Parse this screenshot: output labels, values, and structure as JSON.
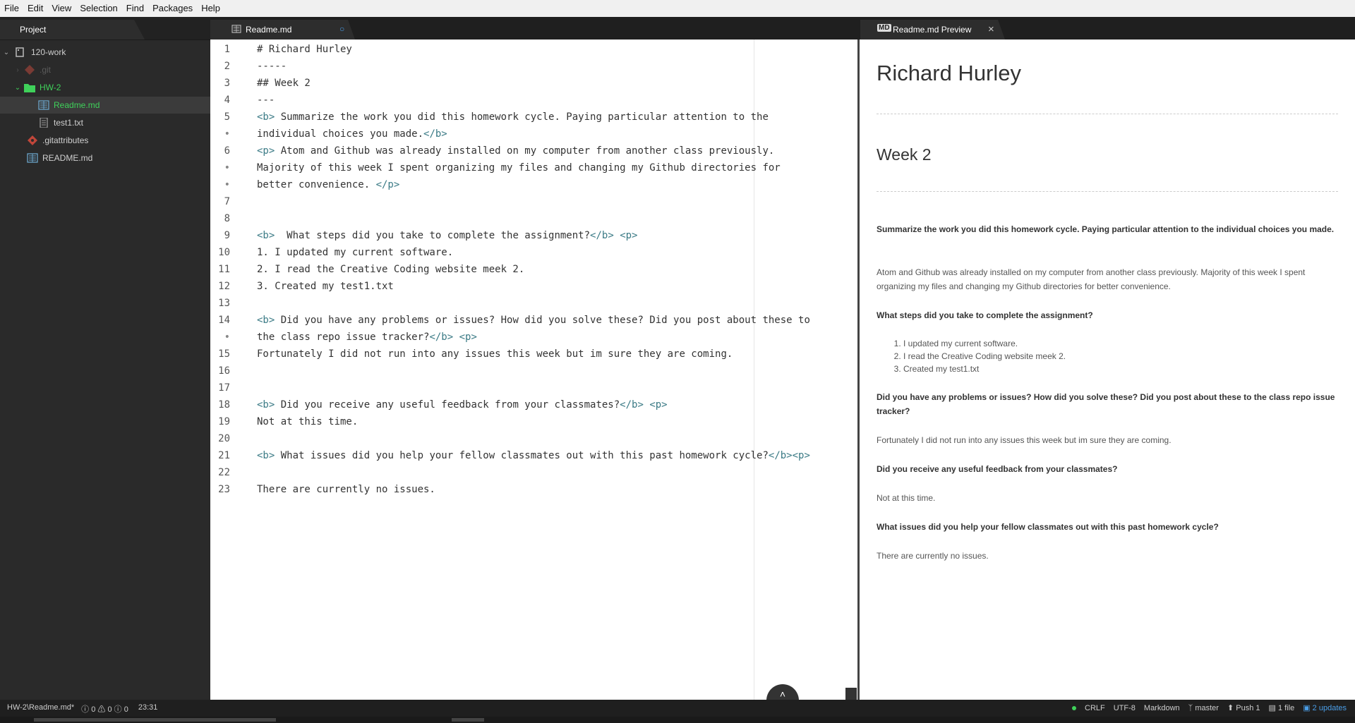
{
  "menu": [
    "File",
    "Edit",
    "View",
    "Selection",
    "Find",
    "Packages",
    "Help"
  ],
  "sidebar": {
    "tab_label": "Project",
    "tree": [
      {
        "label": "120-work",
        "color": "#cfcfcf"
      },
      {
        "label": ".git",
        "color": "#5a5a5a"
      },
      {
        "label": "HW-2",
        "color": "#3fd15a"
      },
      {
        "label": "Readme.md",
        "color": "#3fd15a"
      },
      {
        "label": "test1.txt",
        "color": "#cfcfcf"
      },
      {
        "label": ".gitattributes",
        "color": "#cfcfcf"
      },
      {
        "label": "README.md",
        "color": "#cfcfcf"
      }
    ]
  },
  "editor_tab": {
    "label": "Readme.md",
    "modified_dot": "○"
  },
  "preview_tab": {
    "label": "Readme.md Preview",
    "close": "×"
  },
  "code_lines": [
    {
      "n": "1",
      "segments": [
        {
          "t": "# Richard Hurley"
        }
      ]
    },
    {
      "n": "2",
      "segments": [
        {
          "t": "-----"
        }
      ]
    },
    {
      "n": "3",
      "segments": [
        {
          "t": "## Week 2"
        }
      ]
    },
    {
      "n": "4",
      "segments": [
        {
          "t": "---"
        }
      ]
    },
    {
      "n": "5",
      "segments": [
        {
          "t": "<b>",
          "tag": true
        },
        {
          "t": " Summarize the work you did this homework cycle. Paying particular attention to the"
        }
      ]
    },
    {
      "n": "•",
      "wrap": true,
      "segments": [
        {
          "t": "individual choices you made."
        },
        {
          "t": "</b>",
          "tag": true
        }
      ]
    },
    {
      "n": "6",
      "segments": [
        {
          "t": "<p>",
          "tag": true
        },
        {
          "t": " Atom and Github was already installed on my computer from another class previously."
        }
      ]
    },
    {
      "n": "•",
      "wrap": true,
      "segments": [
        {
          "t": "Majority of this week I spent organizing my files and changing my Github directories for"
        }
      ]
    },
    {
      "n": "•",
      "wrap": true,
      "segments": [
        {
          "t": "better convenience. "
        },
        {
          "t": "</p>",
          "tag": true
        }
      ]
    },
    {
      "n": "7",
      "segments": []
    },
    {
      "n": "8",
      "segments": []
    },
    {
      "n": "9",
      "segments": [
        {
          "t": "<b>",
          "tag": true
        },
        {
          "t": "  What steps did you take to complete the assignment?"
        },
        {
          "t": "</b>",
          "tag": true
        },
        {
          "t": " "
        },
        {
          "t": "<p>",
          "tag": true
        }
      ]
    },
    {
      "n": "10",
      "segments": [
        {
          "t": "1. I updated my current software."
        }
      ]
    },
    {
      "n": "11",
      "segments": [
        {
          "t": "2. I read the Creative Coding website meek 2."
        }
      ]
    },
    {
      "n": "12",
      "segments": [
        {
          "t": "3. Created my test1.txt"
        }
      ]
    },
    {
      "n": "13",
      "segments": []
    },
    {
      "n": "14",
      "segments": [
        {
          "t": "<b>",
          "tag": true
        },
        {
          "t": " Did you have any problems or issues? How did you solve these? Did you post about these to"
        }
      ]
    },
    {
      "n": "•",
      "wrap": true,
      "segments": [
        {
          "t": "the class repo issue tracker?"
        },
        {
          "t": "</b>",
          "tag": true
        },
        {
          "t": " "
        },
        {
          "t": "<p>",
          "tag": true
        }
      ]
    },
    {
      "n": "15",
      "segments": [
        {
          "t": "Fortunately I did not run into any issues this week but im sure they are coming."
        }
      ]
    },
    {
      "n": "16",
      "segments": []
    },
    {
      "n": "17",
      "segments": []
    },
    {
      "n": "18",
      "segments": [
        {
          "t": "<b>",
          "tag": true
        },
        {
          "t": " Did you receive any useful feedback from your classmates?"
        },
        {
          "t": "</b>",
          "tag": true
        },
        {
          "t": " "
        },
        {
          "t": "<p>",
          "tag": true
        }
      ]
    },
    {
      "n": "19",
      "segments": [
        {
          "t": "Not at this time."
        }
      ]
    },
    {
      "n": "20",
      "segments": []
    },
    {
      "n": "21",
      "segments": [
        {
          "t": "<b>",
          "tag": true
        },
        {
          "t": " What issues did you help your fellow classmates out with this past homework cycle?"
        },
        {
          "t": "</b>",
          "tag": true
        },
        {
          "t": "<p>",
          "tag": true
        }
      ]
    },
    {
      "n": "22",
      "segments": []
    },
    {
      "n": "23",
      "segments": [
        {
          "t": "There are currently no issues."
        }
      ]
    }
  ],
  "preview": {
    "h1": "Richard Hurley",
    "h2": "Week 2",
    "q1": "Summarize the work you did this homework cycle. Paying particular attention to the individual choices you made.",
    "a1": "Atom and Github was already installed on my computer from another class previously. Majority of this week I spent organizing my files and changing my Github directories for better convenience.",
    "q2": "What steps did you take to complete the assignment?",
    "list": [
      "I updated my current software.",
      "I read the Creative Coding website meek 2.",
      "Created my test1.txt"
    ],
    "q3": "Did you have any problems or issues? How did you solve these? Did you post about these to the class repo issue tracker?",
    "a3": "Fortunately I did not run into any issues this week but im sure they are coming.",
    "q4": "Did you receive any useful feedback from your classmates?",
    "a4": "Not at this time.",
    "q5": "What issues did you help your fellow classmates out with this past homework cycle?",
    "a5": "There are currently no issues."
  },
  "scroll_button": "˄",
  "status": {
    "path": "HW-2\\Readme.md*",
    "errors": "ⓘ 0",
    "warnings": "⚠ 0",
    "infos": "ⓘ 0",
    "cursor": "23:31",
    "line_ending": "CRLF",
    "encoding": "UTF-8",
    "grammar": "Markdown",
    "branch": "master",
    "push": "Push 1",
    "files": "1 file",
    "updates": "2 updates",
    "updates_color": "#4a9ee8",
    "dot_color": "#3fd15a"
  }
}
